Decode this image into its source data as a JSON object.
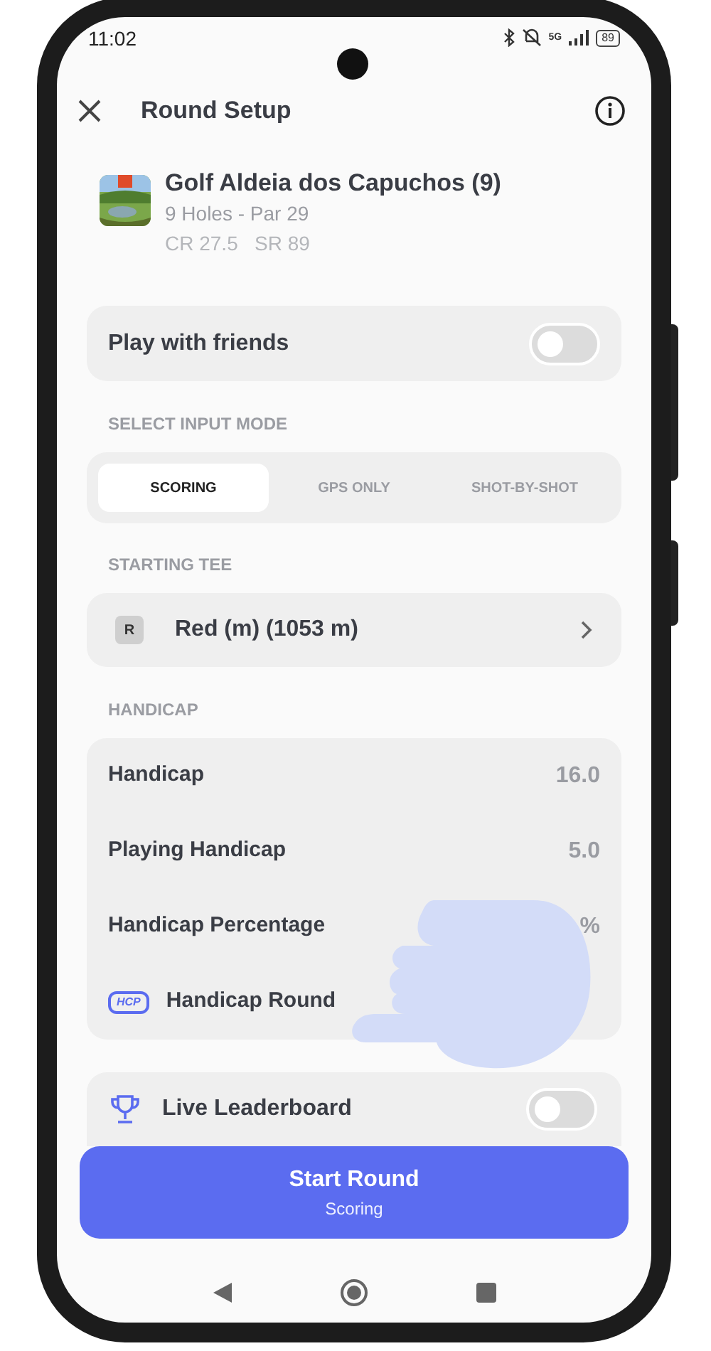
{
  "status_bar": {
    "time": "11:02",
    "network": "5G",
    "battery": "89"
  },
  "header": {
    "title": "Round Setup"
  },
  "course": {
    "name": "Golf Aldeia dos Capuchos (9)",
    "holes": "9 Holes - Par 29",
    "ratings": "CR 27.5   SR 89"
  },
  "play_with_friends": {
    "label": "Play with friends",
    "on": false
  },
  "input_mode": {
    "label": "SELECT INPUT MODE",
    "tabs": [
      {
        "label": "SCORING",
        "selected": true
      },
      {
        "label": "GPS ONLY",
        "selected": false
      },
      {
        "label": "SHOT-BY-SHOT",
        "selected": false
      }
    ]
  },
  "starting_tee": {
    "label": "STARTING TEE",
    "badge": "R",
    "value": "Red (m) (1053 m)"
  },
  "handicap": {
    "label": "HANDICAP",
    "rows": [
      {
        "kind": "value",
        "label": "Handicap",
        "value": "16.0"
      },
      {
        "kind": "value",
        "label": "Playing Handicap",
        "value": "5.0"
      },
      {
        "kind": "value",
        "label": "Handicap Percentage",
        "value": "%"
      },
      {
        "kind": "badge",
        "badge": "HCP",
        "label": "Handicap Round"
      }
    ]
  },
  "live_leaderboard": {
    "label": "Live Leaderboard",
    "on": false
  },
  "start_button": {
    "title": "Start Round",
    "subtitle": "Scoring"
  }
}
